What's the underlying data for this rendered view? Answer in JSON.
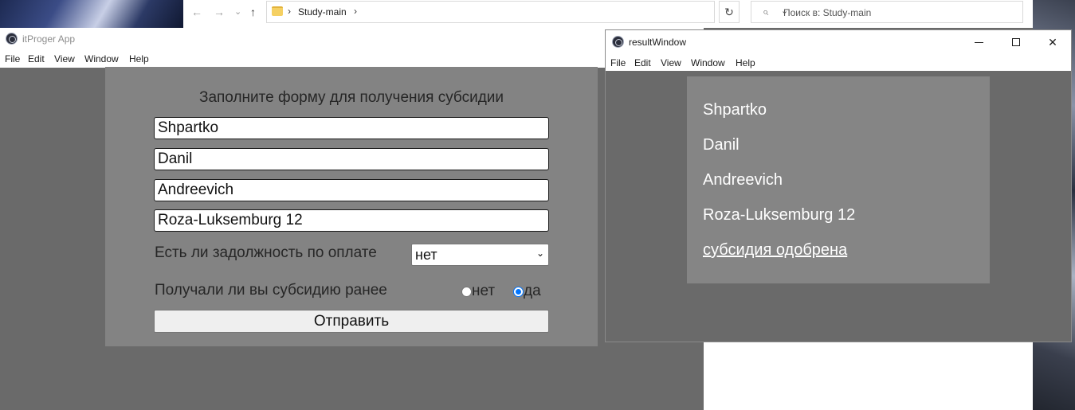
{
  "explorer": {
    "nav_back": "←",
    "nav_forward": "→",
    "nav_recent": "⌄",
    "nav_up": "↑",
    "breadcrumb_separator": "›",
    "folder": "Study-main",
    "breadcrumb_chevron": "›",
    "address_dropdown": "⌄",
    "refresh": "↻",
    "search_placeholder": "Поиск в: Study-main"
  },
  "app_window": {
    "title": "itProger App",
    "menu": [
      "File",
      "Edit",
      "View",
      "Window",
      "Help"
    ],
    "form": {
      "title": "Заполните форму для получения субсидии",
      "surname": "Shpartko",
      "name": "Danil",
      "patronymic": "Andreevich",
      "address": "Roza-Luksemburg 12",
      "debt_label": "Есть ли задолжность по оплате",
      "debt_value": "нет",
      "debt_chevron": "⌄",
      "subsidy_label": "Получали ли вы субсидию ранее",
      "radio_no": "нет",
      "radio_yes": "да",
      "radio_selected": "да",
      "submit": "Отправить"
    }
  },
  "result_window": {
    "title": "resultWindow",
    "close_symbol": "✕",
    "menu": [
      "File",
      "Edit",
      "View",
      "Window",
      "Help"
    ],
    "lines": [
      "Shpartko",
      "Danil",
      "Andreevich",
      "Roza-Luksemburg 12"
    ],
    "result": "субсидия одобрена"
  },
  "colors": {
    "window_bg": "#6a6a6a",
    "form_panel": "#838383",
    "result_panel": "#858585",
    "radio_accent": "#0075ff"
  }
}
